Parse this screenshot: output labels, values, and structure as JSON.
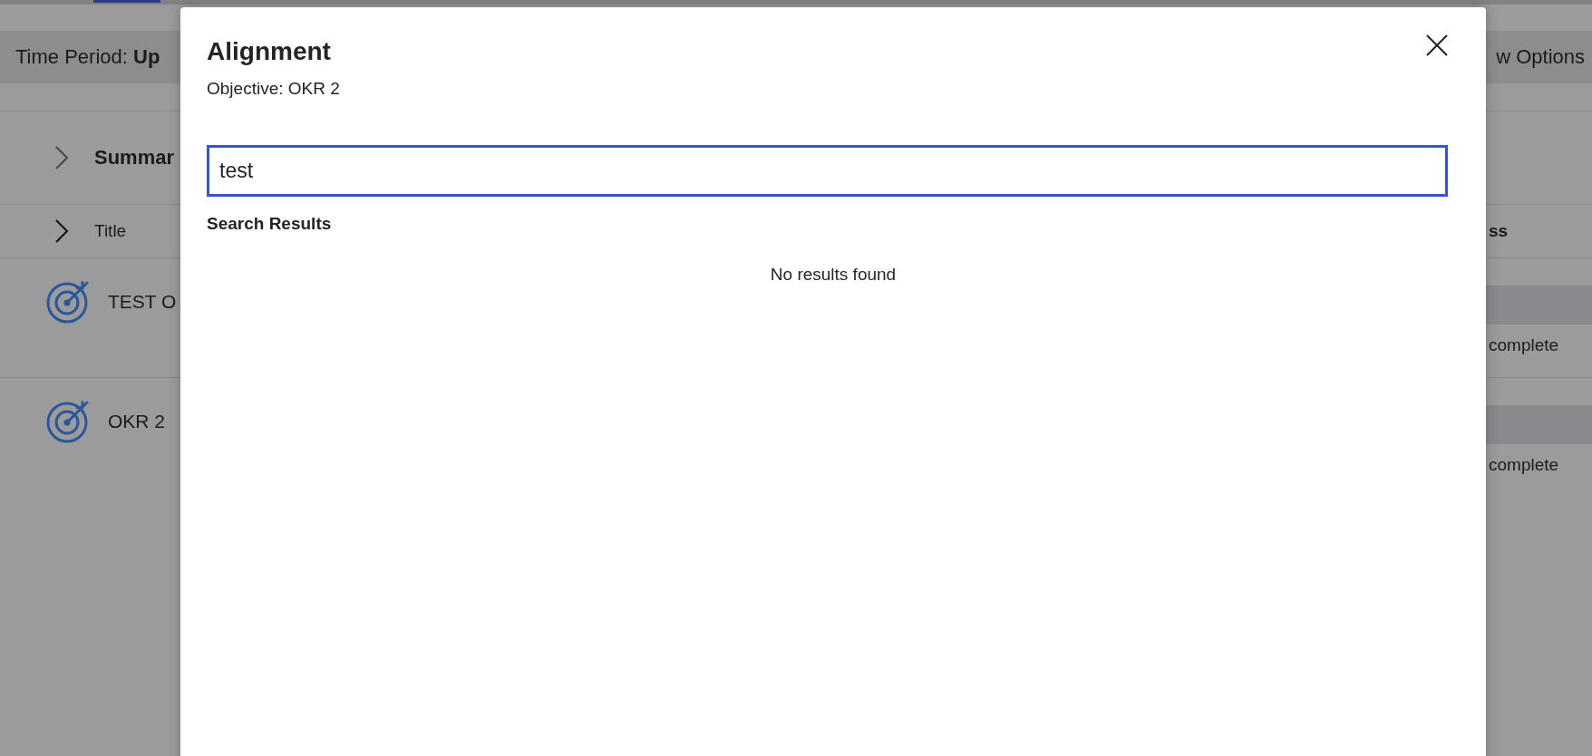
{
  "page": {
    "filter_bar": {
      "label": "Time Period: **Up**",
      "view_options": "w Options"
    },
    "summary": {
      "label": "Summar",
      "expanded": false
    },
    "table": {
      "expanded": false,
      "columns": [
        "Title",
        "ss"
      ],
      "rows": [
        {
          "title": "TEST O",
          "progress": "complete"
        },
        {
          "title": "OKR 2",
          "progress": "complete"
        }
      ]
    }
  },
  "dialog": {
    "title": "Alignment",
    "subtitle": "Objective: OKR 2",
    "search": {
      "value": "test",
      "focused": true
    },
    "results_heading": "Search Results",
    "empty_message": "No results found"
  }
}
